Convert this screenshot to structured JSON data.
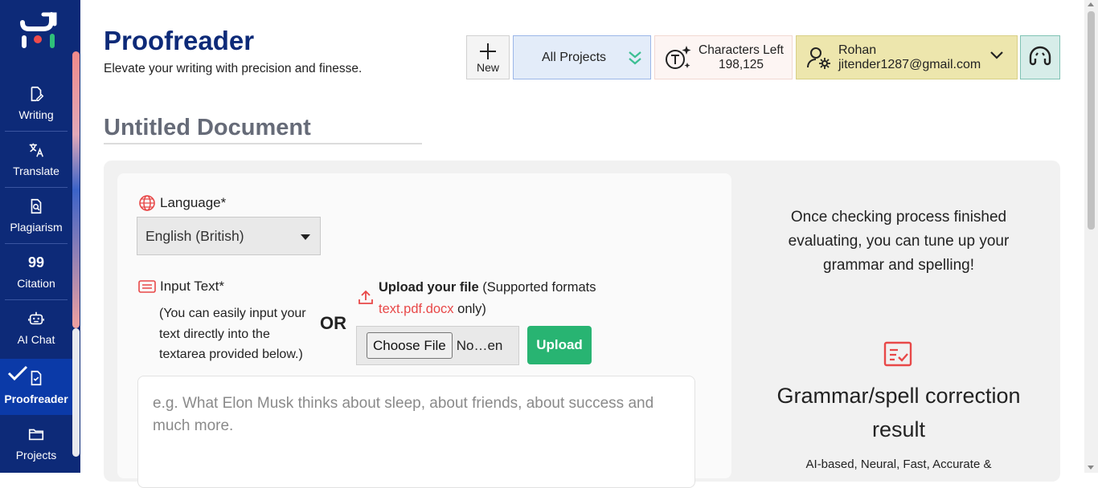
{
  "sidebar": {
    "items": [
      {
        "label": "Writing",
        "icon": "writing-icon"
      },
      {
        "label": "Translate",
        "icon": "translate-icon"
      },
      {
        "label": "Plagiarism",
        "icon": "plagiarism-icon"
      },
      {
        "label": "Citation",
        "icon": "quote-icon"
      },
      {
        "label": "AI Chat",
        "icon": "robot-icon"
      },
      {
        "label": "Proofreader",
        "icon": "proofreader-icon",
        "active": true
      },
      {
        "label": "Projects",
        "icon": "folder-icon"
      }
    ],
    "citation_glyph": "99"
  },
  "header": {
    "title": "Proofreader",
    "subtitle": "Elevate your writing with precision and finesse."
  },
  "toolbar": {
    "new_label": "New",
    "projects_label": "All Projects",
    "chars_label": "Characters Left",
    "chars_value": "198,125",
    "user_name": "Rohan",
    "user_email": "jitender1287@gmail.com"
  },
  "document": {
    "title": "Untitled Document"
  },
  "form": {
    "language_label": "Language*",
    "language_value": "English (British)",
    "input_label": "Input Text*",
    "input_help": "(You can easily input your text directly into the textarea provided below.)",
    "or_label": "OR",
    "upload_title": "Upload your file",
    "upload_formats_prefix": " (Supported formats ",
    "upload_formats": "text.pdf.docx",
    "upload_formats_suffix": " only)",
    "choose_file_label": "Choose File",
    "file_name": "No…en",
    "upload_button": "Upload",
    "textarea_placeholder": "e.g. What Elon Musk thinks about sleep, about friends, about success and much more."
  },
  "result": {
    "message": "Once checking process finished evaluating, you can tune up your grammar and spelling!",
    "title": "Grammar/spell correction result",
    "subtitle": "AI-based, Neural, Fast, Accurate &"
  },
  "colors": {
    "sidebar_bg": "#0d2a78",
    "brand_title": "#0d2a78",
    "upload_green": "#28b472",
    "accent_red": "#e84848"
  }
}
